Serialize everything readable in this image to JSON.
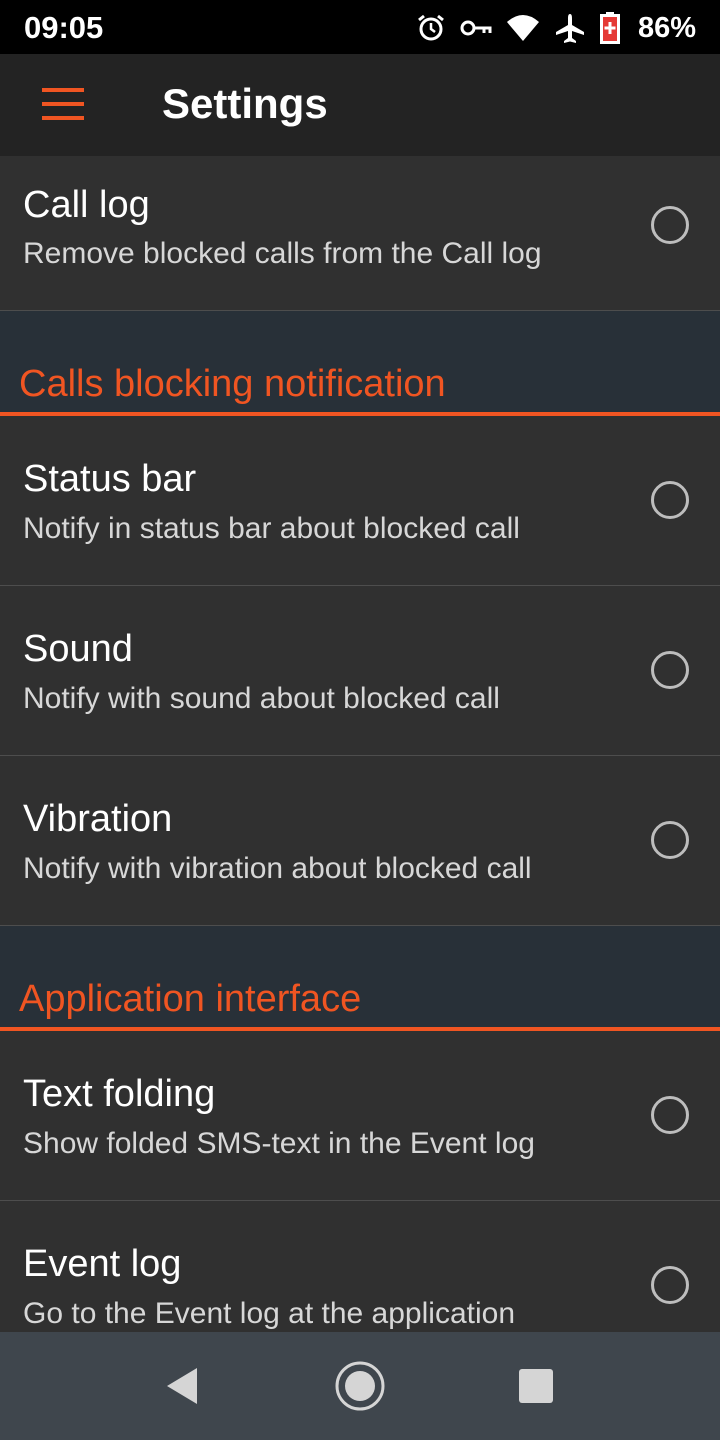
{
  "status_bar": {
    "time": "09:05",
    "battery_percent": "86%",
    "icons": [
      "alarm-icon",
      "vpn-key-icon",
      "wifi-icon",
      "airplane-icon",
      "battery-icon"
    ]
  },
  "app_bar": {
    "title": "Settings",
    "menu_icon": "hamburger-menu-icon",
    "accent_color": "#f05522"
  },
  "sections": {
    "top": {
      "items": [
        {
          "title": "Call log",
          "summary": "Remove blocked calls from the Call log",
          "checked": false
        }
      ]
    },
    "calls_blocking_notification": {
      "header": "Calls blocking notification",
      "items": [
        {
          "title": "Status bar",
          "summary": "Notify in status bar about blocked call",
          "checked": false
        },
        {
          "title": "Sound",
          "summary": "Notify with sound about blocked call",
          "checked": false
        },
        {
          "title": "Vibration",
          "summary": "Notify with vibration about blocked call",
          "checked": false
        }
      ]
    },
    "application_interface": {
      "header": "Application interface",
      "items": [
        {
          "title": "Text folding",
          "summary": "Show folded SMS-text in the Event log",
          "checked": false
        },
        {
          "title": "Event log",
          "summary": "Go to the Event log at the application",
          "checked": false
        }
      ]
    }
  },
  "nav_bar": {
    "icons": [
      "back-icon",
      "home-icon",
      "recents-icon"
    ]
  }
}
